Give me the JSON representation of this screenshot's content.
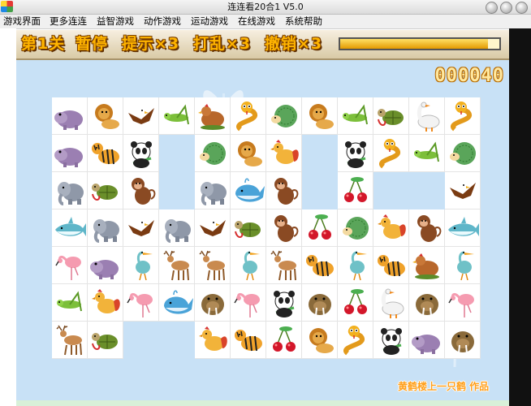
{
  "window": {
    "title": "连连看20合1 V5.0"
  },
  "menu": [
    {
      "id": "menu-game-interface",
      "label": "游戏界面"
    },
    {
      "id": "menu-more-lianliankan",
      "label": "更多连连"
    },
    {
      "id": "menu-puzzle-games",
      "label": "益智游戏"
    },
    {
      "id": "menu-action-games",
      "label": "动作游戏"
    },
    {
      "id": "menu-sports-games",
      "label": "运动游戏"
    },
    {
      "id": "menu-online-games",
      "label": "在线游戏"
    },
    {
      "id": "menu-system-help",
      "label": "系统帮助"
    }
  ],
  "hud": {
    "level": "第1关",
    "pause": "暂停",
    "hint": "提示×3",
    "shuffle": "打乱×3",
    "undo": "撤销×3",
    "timer_fraction": 0.93,
    "score": "000040"
  },
  "credit": "黄鹤楼上一只鹤 作品",
  "colors": {
    "board_bg": "#c8e1f6",
    "hud_text": "#ffb400",
    "timer_fill": "#e39a00",
    "credit_text": "#ff9f1a"
  },
  "tile_kinds": {
    "hippo": "hippo-icon",
    "lion": "lion-icon",
    "eagle": "eagle-icon",
    "grasshopper": "grasshopper-icon",
    "hen": "hen-icon",
    "snake": "snake-icon",
    "hedgehog": "hedgehog-icon",
    "turtle": "turtle-icon",
    "goose": "goose-icon",
    "tiger": "tiger-icon",
    "panda": "panda-icon",
    "rooster": "rooster-icon",
    "elephant": "elephant-icon",
    "whale": "whale-icon",
    "monkey": "monkey-icon",
    "cherries": "cherries-icon",
    "shark": "shark-icon",
    "flamingo": "flamingo-icon",
    "heron": "heron-icon",
    "deer": "deer-icon",
    "walrus": "walrus-icon",
    "empty": ""
  },
  "grid": [
    [
      "hippo",
      "lion",
      "eagle",
      "grasshopper",
      "hen",
      "snake",
      "hedgehog",
      "lion",
      "grasshopper",
      "turtle",
      "goose",
      "snake"
    ],
    [
      "hippo",
      "tiger",
      "panda",
      "empty",
      "hedgehog",
      "lion",
      "rooster",
      "empty",
      "panda",
      "snake",
      "grasshopper",
      "hedgehog"
    ],
    [
      "elephant",
      "turtle",
      "monkey",
      "empty",
      "elephant",
      "whale",
      "monkey",
      "empty",
      "cherries",
      "empty",
      "empty",
      "eagle"
    ],
    [
      "shark",
      "elephant",
      "eagle",
      "elephant",
      "eagle",
      "turtle",
      "monkey",
      "cherries",
      "hedgehog",
      "rooster",
      "monkey",
      "shark"
    ],
    [
      "flamingo",
      "hippo",
      "heron",
      "deer",
      "deer",
      "heron",
      "deer",
      "tiger",
      "heron",
      "tiger",
      "hen",
      "heron"
    ],
    [
      "grasshopper",
      "rooster",
      "flamingo",
      "whale",
      "walrus",
      "flamingo",
      "panda",
      "walrus",
      "cherries",
      "goose",
      "walrus",
      "flamingo"
    ],
    [
      "deer",
      "turtle",
      "empty",
      "empty",
      "rooster",
      "tiger",
      "cherries",
      "lion",
      "snake",
      "panda",
      "hippo",
      "walrus"
    ]
  ]
}
